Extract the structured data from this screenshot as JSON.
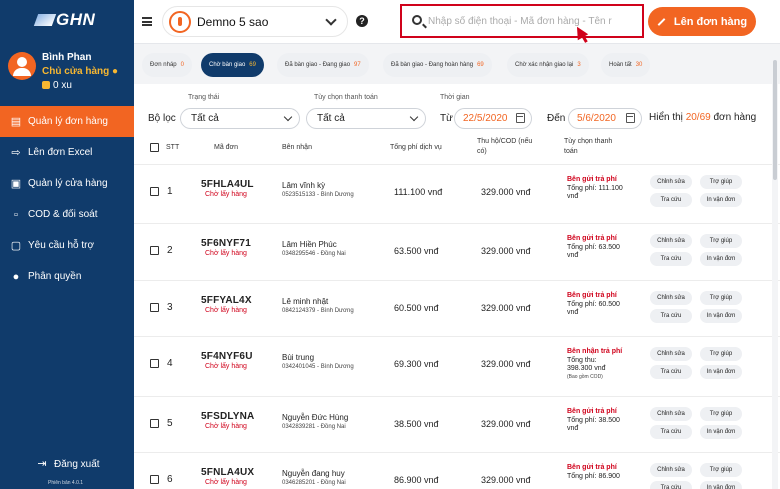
{
  "app": {
    "logo_text": "GHN",
    "version": "Phiên bản 4.0.1"
  },
  "user": {
    "name": "Bình Phan",
    "role": "Chủ cửa hàng",
    "coins": "0 xu"
  },
  "nav": [
    {
      "label": "Quản lý đơn hàng",
      "icon": "clipboard-icon"
    },
    {
      "label": "Lên đơn Excel",
      "icon": "excel-icon"
    },
    {
      "label": "Quản lý cửa hàng",
      "icon": "store-icon"
    },
    {
      "label": "COD & đối soát",
      "icon": "money-icon"
    },
    {
      "label": "Yêu cầu hỗ trợ",
      "icon": "support-icon"
    },
    {
      "label": "Phân quyền",
      "icon": "users-icon"
    }
  ],
  "logout_label": "Đăng xuất",
  "topbar": {
    "store_name": "Demno 5 sao",
    "search_placeholder": "Nhập số điện thoại - Mã đơn hàng - Tên r",
    "create_label": "Lên đơn hàng"
  },
  "tabs": [
    {
      "label": "Đơn nháp",
      "count": "0"
    },
    {
      "label": "Chờ bàn giao",
      "count": "69"
    },
    {
      "label": "Đã bàn giao - Đang giao",
      "count": "97"
    },
    {
      "label": "Đã bàn giao - Đang hoàn hàng",
      "count": "69"
    },
    {
      "label": "Chờ xác nhận giao lại",
      "count": "3"
    },
    {
      "label": "Hoàn tất",
      "count": "30"
    }
  ],
  "filters": {
    "title": "Bộ lọc",
    "status_label": "Trạng thái",
    "status_value": "Tất cả",
    "payment_label": "Tùy chọn thanh toán",
    "payment_value": "Tất cả",
    "time_label": "Thời gian",
    "from_label": "Từ",
    "from_date": "22/5/2020",
    "to_label": "Đến",
    "to_date": "5/6/2020",
    "summary_prefix": "Hiển thị",
    "summary_count": "20/69",
    "summary_suffix": "đơn hàng"
  },
  "table": {
    "headers": {
      "stt": "STT",
      "code": "Mã đơn",
      "receiver": "Bên nhận",
      "fee": "Tổng phí dịch vụ",
      "cod_line1": "Thu hộ/COD (nếu",
      "cod_line2": "có)",
      "pay_line1": "Tùy chọn thanh",
      "pay_line2": "toán"
    },
    "actions": {
      "edit": "Chỉnh sửa",
      "help": "Trợ giúp",
      "lookup": "Tra cứu",
      "print": "In vận đơn"
    },
    "rows": [
      {
        "stt": "1",
        "code": "5FHLA4UL",
        "status": "Chờ lấy hàng",
        "name": "Lâm vĩnh kỳ",
        "sub": "0523515133 - Bình Dương",
        "fee": "111.100 vnđ",
        "cod": "329.000 vnđ",
        "pay_main": "Bên gửi trả phí",
        "pay_line1": "Tổng phí: 111.100",
        "pay_line2": "vnđ",
        "pay_note": ""
      },
      {
        "stt": "2",
        "code": "5F6NYF71",
        "status": "Chờ lấy hàng",
        "name": "Lâm Hiền Phúc",
        "sub": "0348295546 - Đồng Nai",
        "fee": "63.500 vnđ",
        "cod": "329.000 vnđ",
        "pay_main": "Bên gửi trả phí",
        "pay_line1": "Tổng phí: 63.500",
        "pay_line2": "vnđ",
        "pay_note": ""
      },
      {
        "stt": "3",
        "code": "5FFYAL4X",
        "status": "Chờ lấy hàng",
        "name": "Lê minh nhật",
        "sub": "0842124379 - Bình Dương",
        "fee": "60.500 vnđ",
        "cod": "329.000 vnđ",
        "pay_main": "Bên gửi trả phí",
        "pay_line1": "Tổng phí: 60.500",
        "pay_line2": "vnđ",
        "pay_note": ""
      },
      {
        "stt": "4",
        "code": "5F4NYF6U",
        "status": "Chờ lấy hàng",
        "name": "Bùi trung",
        "sub": "0342401045 - Bình Dương",
        "fee": "69.300 vnđ",
        "cod": "329.000 vnđ",
        "pay_main": "Bên nhận trả phí",
        "pay_line1": "Tổng thu:",
        "pay_line2": "398.300 vnđ",
        "pay_note": "(Bao gồm COD)"
      },
      {
        "stt": "5",
        "code": "5FSDLYNA",
        "status": "Chờ lấy hàng",
        "name": "Nguyễn Đức Hùng",
        "sub": "0342839281 - Đồng Nai",
        "fee": "38.500 vnđ",
        "cod": "329.000 vnđ",
        "pay_main": "Bên gửi trả phí",
        "pay_line1": "Tổng phí: 38.500",
        "pay_line2": "vnđ",
        "pay_note": ""
      },
      {
        "stt": "6",
        "code": "5FNLA4UX",
        "status": "Chờ lấy hàng",
        "name": "Nguyễn đang huy",
        "sub": "0346285201 - Đồng Nai",
        "fee": "86.900 vnđ",
        "cod": "329.000 vnđ",
        "pay_main": "Bên gửi trả phí",
        "pay_line1": "Tổng phí: 86.900",
        "pay_line2": "",
        "pay_note": ""
      }
    ]
  },
  "colors": {
    "brand_navy": "#103b6b",
    "accent_orange": "#f26522",
    "alert_red": "#d0021b"
  }
}
